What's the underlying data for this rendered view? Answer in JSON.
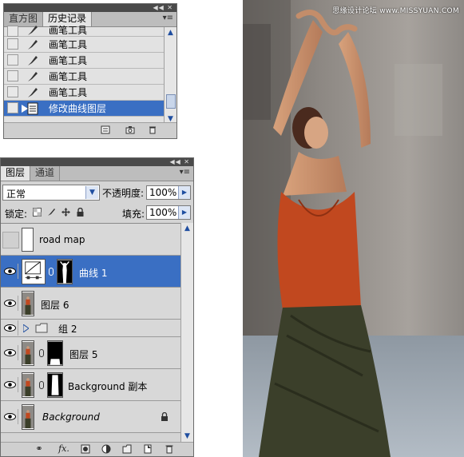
{
  "history_panel": {
    "tabs": [
      "直方图",
      "历史记录"
    ],
    "active_tab": 1,
    "steps": [
      {
        "label": "画笔工具",
        "icon": "brush-icon"
      },
      {
        "label": "画笔工具",
        "icon": "brush-icon"
      },
      {
        "label": "画笔工具",
        "icon": "brush-icon"
      },
      {
        "label": "画笔工具",
        "icon": "brush-icon"
      },
      {
        "label": "画笔工具",
        "icon": "brush-icon"
      },
      {
        "label": "修改曲线图层",
        "icon": "curves-step-icon",
        "selected": true
      }
    ]
  },
  "layers_panel": {
    "tabs": [
      "图层",
      "通道"
    ],
    "active_tab": 0,
    "blend_mode": "正常",
    "opacity_label": "不透明度:",
    "opacity_value": "100%",
    "lock_label": "锁定:",
    "fill_label": "填充:",
    "fill_value": "100%",
    "layers": [
      {
        "name": "road map",
        "visible": false,
        "thumb": "transparent"
      },
      {
        "name": "曲线 1",
        "visible": true,
        "thumb": "curves-adjustment",
        "mask": true,
        "selected": true
      },
      {
        "name": "图层 6",
        "visible": true,
        "thumb": "figure"
      },
      {
        "name": "组 2",
        "visible": true,
        "thumb": "folder",
        "collapsed": true
      },
      {
        "name": "图层 5",
        "visible": true,
        "thumb": "figure",
        "mask": true
      },
      {
        "name": "Background 副本",
        "visible": true,
        "thumb": "figure",
        "mask": true
      },
      {
        "name": "Background",
        "visible": true,
        "thumb": "figure",
        "locked": true,
        "italic": true
      }
    ],
    "bottom_icons": [
      "link-layers-icon",
      "fx-icon",
      "add-mask-icon",
      "adjustment-layer-icon",
      "new-group-icon",
      "new-layer-icon",
      "delete-layer-icon"
    ]
  },
  "photo": {
    "watermark": "思缘设计论坛 www.MISSYUAN.COM",
    "subject": "dancer with raised arms",
    "colors": {
      "wall": "#8a8580",
      "top": "#c1481f",
      "skirt": "#3b3f2a",
      "floor": "#9aa3ab"
    }
  },
  "colors": {
    "selection": "#3a6fc3",
    "panel_bg": "#d4d4d4",
    "titlebar": "#4a4a4a"
  }
}
